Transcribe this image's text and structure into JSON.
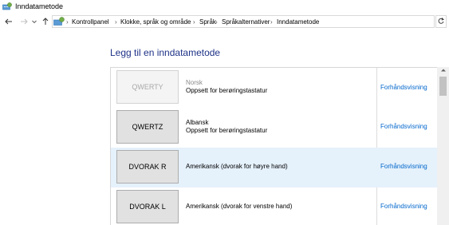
{
  "window": {
    "title": "Inndatametode",
    "icon": "keyboard-globe-icon"
  },
  "nav": {
    "back_icon": "arrow-left-icon",
    "forward_icon": "arrow-right-icon",
    "up_icon": "arrow-up-icon",
    "refresh_icon": "refresh-icon"
  },
  "breadcrumb": [
    "Kontrollpanel",
    "Klokke, språk og område",
    "Språk",
    "Språkalternativer",
    "Inndatametode"
  ],
  "page": {
    "heading": "Legg til en inndatametode"
  },
  "methods": [
    {
      "key": "QWERTY",
      "language": "Norsk",
      "layout": "Oppsett for berøringstastatur",
      "preview": "Forhåndsvisning",
      "disabled": true
    },
    {
      "key": "QWERTZ",
      "language": "Albansk",
      "layout": "Oppsett for berøringstastatur",
      "preview": "Forhåndsvisning",
      "disabled": false
    },
    {
      "key": "DVORAK R",
      "language": "Amerikansk (dvorak for høyre hand)",
      "preview": "Forhåndsvisning",
      "disabled": false,
      "highlighted": true
    },
    {
      "key": "DVORAK L",
      "language": "Amerikansk (dvorak for venstre hand)",
      "preview": "Forhåndsvisning",
      "disabled": false
    }
  ],
  "colors": {
    "heading": "#1e3287",
    "link": "#0066cc",
    "highlight": "#e5f1fb"
  }
}
